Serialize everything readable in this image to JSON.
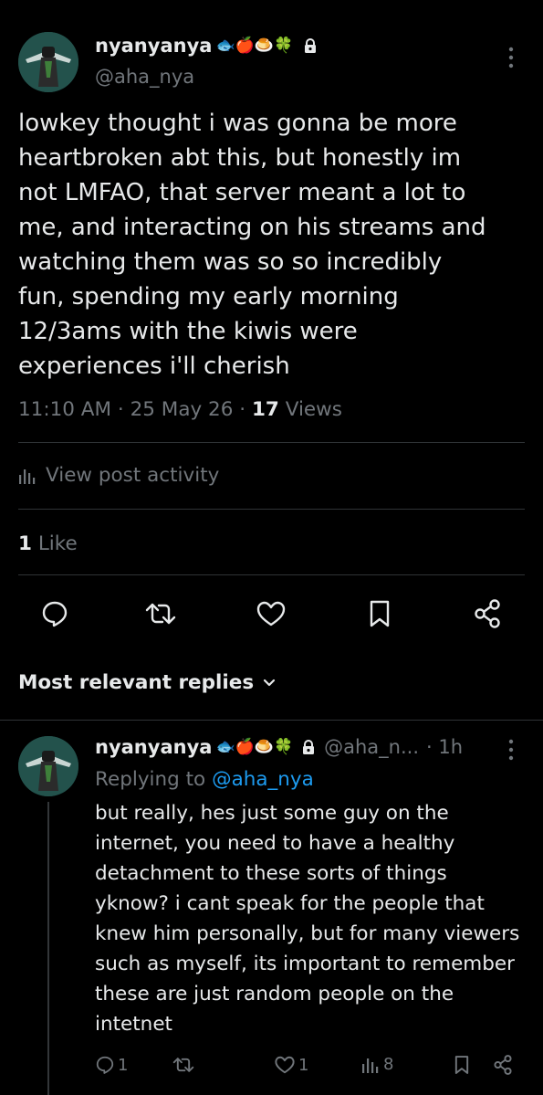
{
  "post": {
    "display_name": "nyanyanya",
    "emoji_badges": "🐟🍎🍮🍀",
    "handle": "@aha_nya",
    "text": "lowkey thought i was gonna be more heartbroken abt this, but honestly im not LMFAO, that server meant a lot to me, and interacting on his streams and watching them was so so incredibly fun, spending my early morning 12/3ams with the kiwis were experiences i'll cherish",
    "time": "11:10 AM",
    "date": "25 May 26",
    "views_count": "17",
    "views_label": "Views",
    "activity_label": "View post activity",
    "likes_count": "1",
    "likes_label": "Like"
  },
  "replies_header": "Most relevant replies",
  "reply": {
    "display_name": "nyanyanya",
    "emoji_badges": "🐟🍎🍮🍀",
    "handle": "@aha_n...",
    "age": "· 1h",
    "replying_to_label": "Replying to",
    "replying_to_handle": "@aha_nya",
    "text": "but really, hes just some guy on the internet, you need to have a healthy detachment to these sorts of things yknow? i cant speak for the people that knew him personally, but for many viewers such as myself, its important to remember these are just random people on the intetnet",
    "reply_count": "1",
    "like_count": "1",
    "view_count": "8"
  },
  "colors": {
    "background": "#000000",
    "text": "#e7e9ea",
    "muted": "#71767b",
    "link": "#1d9bf0",
    "divider": "#2f3336"
  }
}
